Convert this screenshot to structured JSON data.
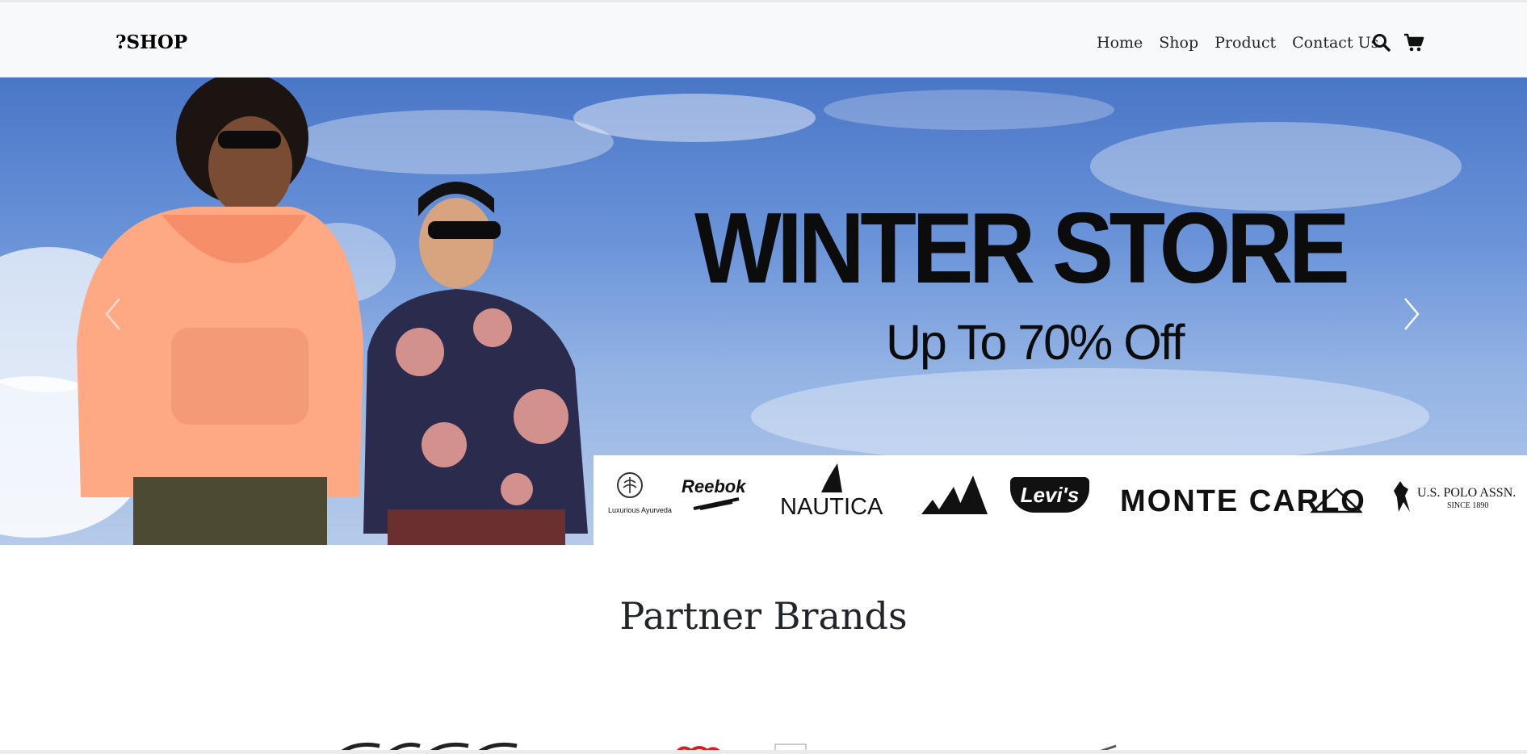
{
  "navbar": {
    "brand": "?SHOP",
    "links": [
      "Home",
      "Shop",
      "Product",
      "Contact Us"
    ],
    "icons": [
      "search-icon",
      "cart-icon"
    ]
  },
  "hero": {
    "title": "WINTER STORE",
    "subtitle": "Up To 70% Off",
    "brand_logos": [
      "Luxurious Ayurveda",
      "Reebok",
      "NAUTICA",
      "adidas",
      "Levi's",
      "MONTE CARLO",
      "U.S. POLO ASSN.",
      "SINCE 1890"
    ],
    "controls": [
      "chevron-left-icon",
      "chevron-right-icon"
    ]
  },
  "partners": {
    "title": "Partner Brands"
  }
}
